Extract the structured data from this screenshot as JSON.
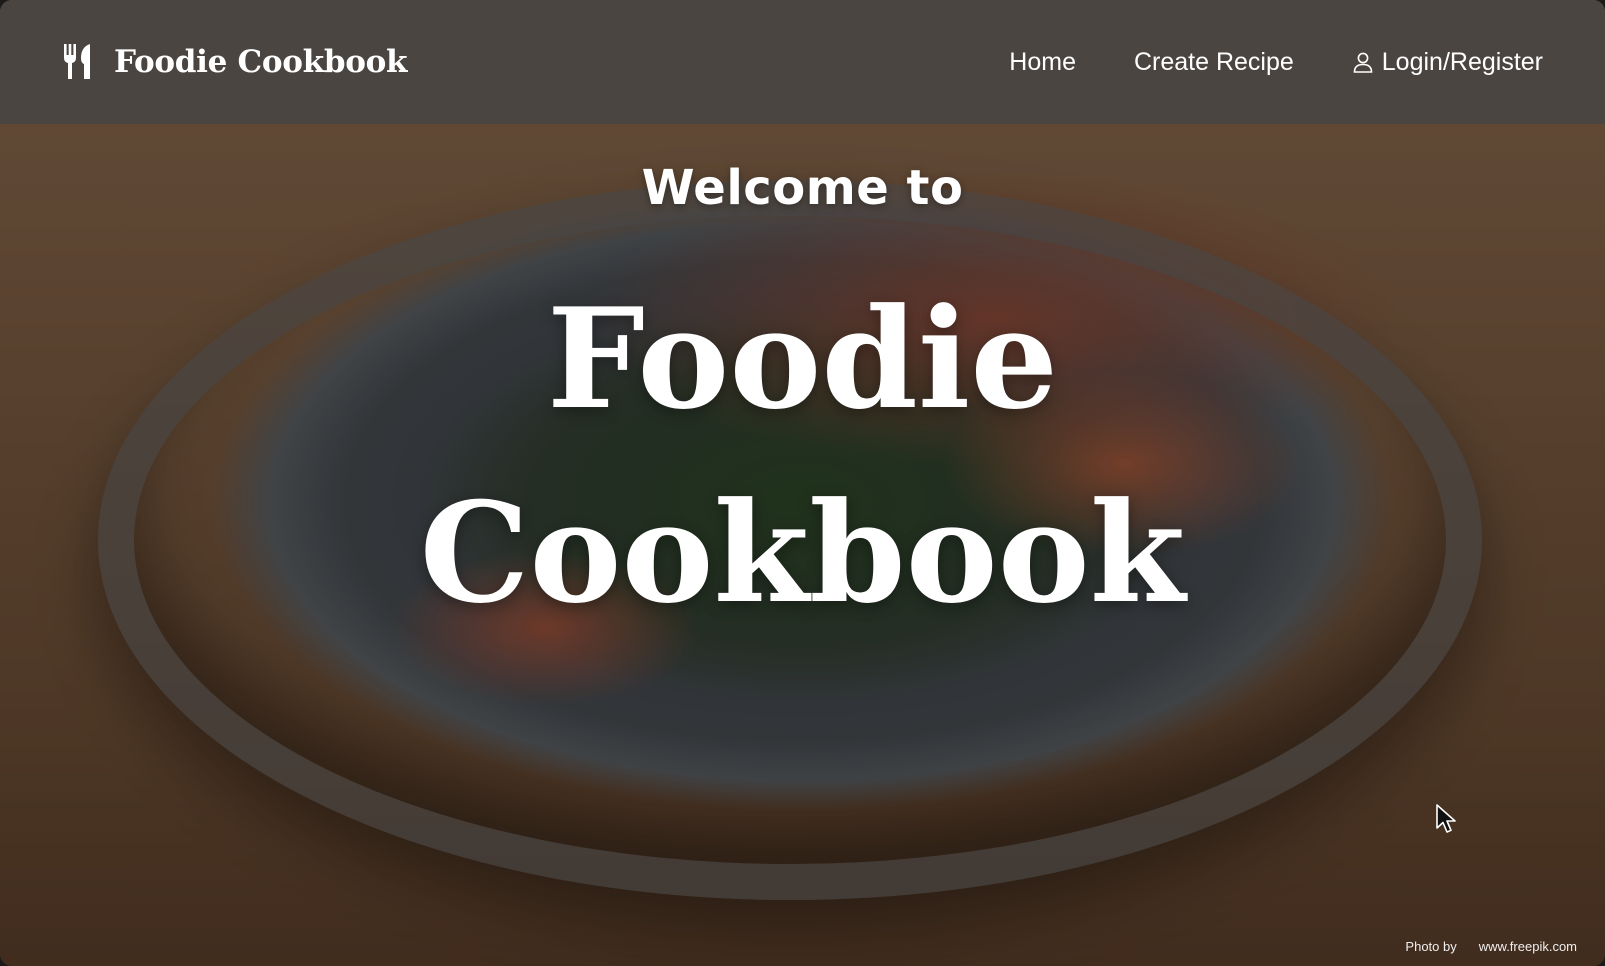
{
  "navbar": {
    "brand_icon": "fork-knife-icon",
    "brand_name": "Foodie Cookbook",
    "links": [
      {
        "label": "Home"
      },
      {
        "label": "Create Recipe"
      },
      {
        "label": "Login/Register",
        "icon": "user-icon"
      }
    ]
  },
  "hero": {
    "welcome": "Welcome to",
    "title_line1": "Foodie",
    "title_line2": "Cookbook",
    "image_description_icon": "salad-photo"
  },
  "credit": {
    "prefix": "Photo by",
    "source": "www.freepik.com"
  },
  "colors": {
    "navbar_bg": "#4a4542",
    "text": "#ffffff"
  }
}
